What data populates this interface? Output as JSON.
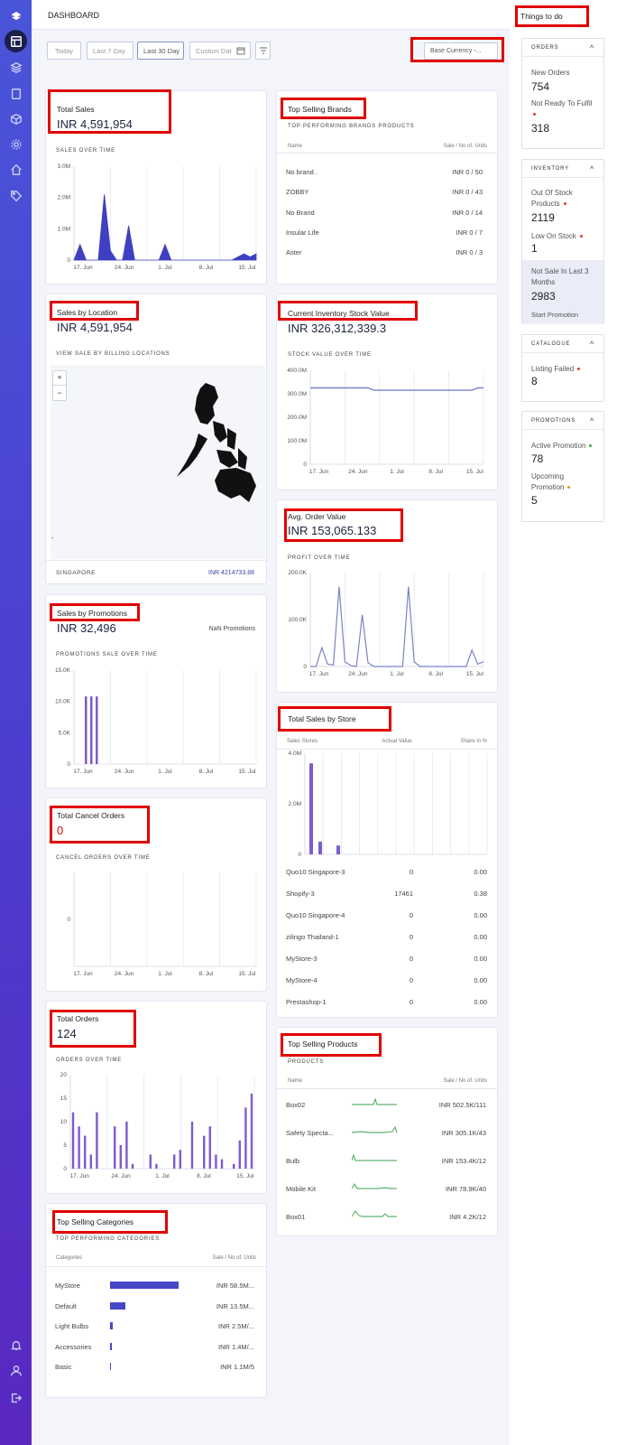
{
  "header": {
    "title": "DASHBOARD",
    "things_to_do": "Things to do"
  },
  "filters": {
    "today": "Today",
    "last7": "Last 7 Day",
    "last30": "Last 30 Day",
    "custom": "Custom Dat",
    "currency": "Base Currency -..."
  },
  "colors": {
    "accent": "#4646c8",
    "bar": "#7e5bce",
    "line": "#7c82c9",
    "danger": "#e00000",
    "sidebar": "#4a4fd8"
  },
  "total_sales": {
    "title": "Total Sales",
    "value": "INR  4,591,954",
    "subtitle": "SALES OVER TIME",
    "y_ticks": [
      "3.0M",
      "2.0M",
      "1.0M",
      "0"
    ],
    "x_ticks": [
      "17. Jun",
      "24. Jun",
      "1. Jul",
      "8. Jul",
      "15. Jul"
    ]
  },
  "top_brands": {
    "title": "Top Selling Brands",
    "subtitle": "TOP PERFORMING BRANDS PRODUCTS",
    "col_name": "Name",
    "col_value": "Sale / No of. Units",
    "rows": [
      {
        "name": "No brand .",
        "value": "INR 0 / 50"
      },
      {
        "name": "ZOBBY",
        "value": "INR 0 / 43"
      },
      {
        "name": "No Brand",
        "value": "INR 0 / 14"
      },
      {
        "name": "Insular Life",
        "value": "INR 0 / 7"
      },
      {
        "name": "Aster",
        "value": "INR 0 / 3"
      }
    ]
  },
  "sales_location": {
    "title": "Sales by Location",
    "value": "INR   4,591,954",
    "subtitle": "VIEW SALE BY BILLING LOCATIONS",
    "zoom_in": "+",
    "zoom_out": "−",
    "mark": "-",
    "footer_country": "SINGAPORE",
    "footer_value": "INR   4214733.88"
  },
  "inventory_value": {
    "title": "Current Inventory Stock Value",
    "value": "INR  326,312,339.3",
    "subtitle": "STOCK VALUE OVER TIME",
    "y_ticks": [
      "400.0M",
      "300.0M",
      "200.0M",
      "100.0M",
      "0"
    ],
    "x_ticks": [
      "17. Jun",
      "24. Jun",
      "1. Jul",
      "8. Jul",
      "15. Jul"
    ]
  },
  "promotions": {
    "title": "Sales by Promotions",
    "value": "INR  32,496",
    "nan_label": "NaN  Promotions",
    "subtitle": "PROMOTIONS SALE OVER TIME",
    "y_ticks": [
      "15.0K",
      "10.0K",
      "5.0K",
      "0"
    ],
    "x_ticks": [
      "17. Jun",
      "24. Jun",
      "1. Jul",
      "8. Jul",
      "15. Jul"
    ]
  },
  "avg_order": {
    "title": "Avg. Order Value",
    "value": "INR  153,065.133",
    "subtitle": "PROFIT OVER TIME",
    "y_ticks": [
      "200.0K",
      "100.0K",
      "0"
    ],
    "x_ticks": [
      "17. Jun",
      "24. Jun",
      "1. Jul",
      "8. Jul",
      "15. Jul"
    ]
  },
  "cancel_orders": {
    "title": "Total Cancel Orders",
    "value": "0",
    "subtitle": "CANCEL ORDERS OVER TIME",
    "y_ticks": [
      "0"
    ],
    "x_ticks": [
      "17. Jun",
      "24. Jun",
      "1. Jul",
      "8. Jul",
      "15. Jul"
    ]
  },
  "store_sales": {
    "title": "Total Sales by Store",
    "col_store": "Sales Stores",
    "col_actual": "Actual Value",
    "col_share": "Share in %",
    "y_ticks": [
      "4.0M",
      "2.0M",
      "0"
    ],
    "rows": [
      {
        "name": "Quo10 Singapore-3",
        "actual": "0",
        "share": "0.00"
      },
      {
        "name": "Shopify-3",
        "actual": "17461",
        "share": "0.38"
      },
      {
        "name": "Quo10 Singapore-4",
        "actual": "0",
        "share": "0.00"
      },
      {
        "name": "zilingo Thailand-1",
        "actual": "0",
        "share": "0.00"
      },
      {
        "name": "MyStore-3",
        "actual": "0",
        "share": "0.00"
      },
      {
        "name": "MyStore-4",
        "actual": "0",
        "share": "0.00"
      },
      {
        "name": "Prestashop-1",
        "actual": "0",
        "share": "0.00"
      }
    ]
  },
  "total_orders": {
    "title": "Total Orders",
    "value": "124",
    "subtitle": "ORDERS OVER TIME",
    "y_ticks": [
      "20",
      "15",
      "10",
      "5",
      "0"
    ],
    "x_ticks": [
      "17. Jun",
      "24. Jun",
      "1. Jul",
      "8. Jul",
      "15. Jul"
    ]
  },
  "top_products": {
    "title": "Top Selling Products",
    "subtitle": "PRODUCTS",
    "col_name": "Name",
    "col_value": "Sale / No of. Units",
    "rows": [
      {
        "name": "Box02",
        "value": "INR 502.5K/111"
      },
      {
        "name": "Safety Specta...",
        "value": "INR 305.1K/43"
      },
      {
        "name": "Bulb",
        "value": "INR 153.4K/12"
      },
      {
        "name": "Mobile Kit",
        "value": "INR 78.9K/40"
      },
      {
        "name": "Box01",
        "value": "INR 4.2K/12"
      }
    ]
  },
  "top_categories": {
    "title": "Top Selling Categories",
    "subtitle": "TOP PERFORMING CATEGORIES",
    "col_name": "Categories",
    "col_value": "Sale / No of. Units",
    "rows": [
      {
        "name": "MyStore",
        "value": "INR 58.5M...",
        "share": 1.0
      },
      {
        "name": "Default",
        "value": "INR 13.5M...",
        "share": 0.23
      },
      {
        "name": "Light Bulbs",
        "value": "INR 2.5M/...",
        "share": 0.043
      },
      {
        "name": "Accessories",
        "value": "INR 1.4M/...",
        "share": 0.024
      },
      {
        "name": "Basic",
        "value": "INR 1.1M/5",
        "share": 0.019
      }
    ]
  },
  "todo": {
    "orders": {
      "header": "ORDERS",
      "new_label": "New Orders",
      "new_value": "754",
      "nr_label": "Not Ready To Fulfil",
      "nr_value": "318"
    },
    "inventory": {
      "header": "INVENTORY",
      "oos_label": "Out Of Stock Products",
      "oos_value": "2119",
      "low_label": "Low On Stock",
      "low_value": "1",
      "ns_label": "Not Sale In Last 3 Months",
      "ns_value": "2983",
      "promo_link": "Start Promotion"
    },
    "catalogue": {
      "header": "CATALOGUE",
      "failed_label": "Listing Failed",
      "failed_value": "8"
    },
    "promotions": {
      "header": "PROMOTIONS",
      "active_label": "Active Promotion",
      "active_value": "78",
      "upcoming_label": "Upcoming Promotion",
      "upcoming_value": "5"
    }
  },
  "chart_data": [
    {
      "type": "area",
      "title": "SALES OVER TIME",
      "x": [
        "17. Jun",
        "18",
        "19",
        "20",
        "21",
        "22",
        "23",
        "24. Jun",
        "25",
        "26",
        "27",
        "28",
        "29",
        "30",
        "1. Jul",
        "2",
        "3",
        "4",
        "5",
        "6",
        "7",
        "8. Jul",
        "9",
        "10",
        "11",
        "12",
        "13",
        "14",
        "15. Jul",
        "16",
        "17"
      ],
      "values": [
        0,
        0.5,
        0,
        0,
        0,
        2.1,
        0.3,
        0,
        0,
        1.1,
        0,
        0,
        0,
        0,
        0,
        0.5,
        0,
        0,
        0,
        0,
        0,
        0,
        0,
        0,
        0,
        0,
        0,
        0.1,
        0.2,
        0.1,
        0.2
      ],
      "ylim": [
        0,
        3
      ]
    },
    {
      "type": "line",
      "title": "STOCK VALUE OVER TIME",
      "values": [
        325,
        325,
        325,
        325,
        325,
        325,
        325,
        325,
        325,
        325,
        325,
        315,
        315,
        315,
        315,
        315,
        315,
        315,
        315,
        315,
        315,
        315,
        315,
        315,
        315,
        315,
        315,
        315,
        315,
        325,
        325
      ],
      "ylim": [
        0,
        400
      ]
    },
    {
      "type": "bar",
      "title": "PROMOTIONS SALE OVER TIME",
      "values": [
        10.8,
        10.8,
        10.8
      ],
      "ylim": [
        0,
        15
      ]
    },
    {
      "type": "line",
      "title": "PROFIT OVER TIME",
      "values": [
        0,
        0,
        40,
        5,
        3,
        170,
        10,
        2,
        0,
        110,
        8,
        0,
        0,
        0,
        0,
        0,
        0,
        170,
        10,
        0,
        0,
        0,
        0,
        0,
        0,
        0,
        0,
        0,
        35,
        5,
        10
      ],
      "ylim": [
        0,
        200
      ]
    },
    {
      "type": "bar",
      "title": "Total Sales by Store",
      "values": [
        3.6,
        0.5,
        0,
        0.35
      ],
      "ylim": [
        0,
        4
      ]
    },
    {
      "type": "bar",
      "title": "ORDERS OVER TIME",
      "values": [
        12,
        9,
        7,
        3,
        12,
        0,
        0,
        9,
        5,
        10,
        1,
        0,
        0,
        3,
        1,
        0,
        0,
        3,
        4,
        0,
        10,
        0,
        7,
        9,
        3,
        2,
        0,
        1,
        6,
        13,
        16
      ],
      "ylim": [
        0,
        20
      ]
    }
  ]
}
